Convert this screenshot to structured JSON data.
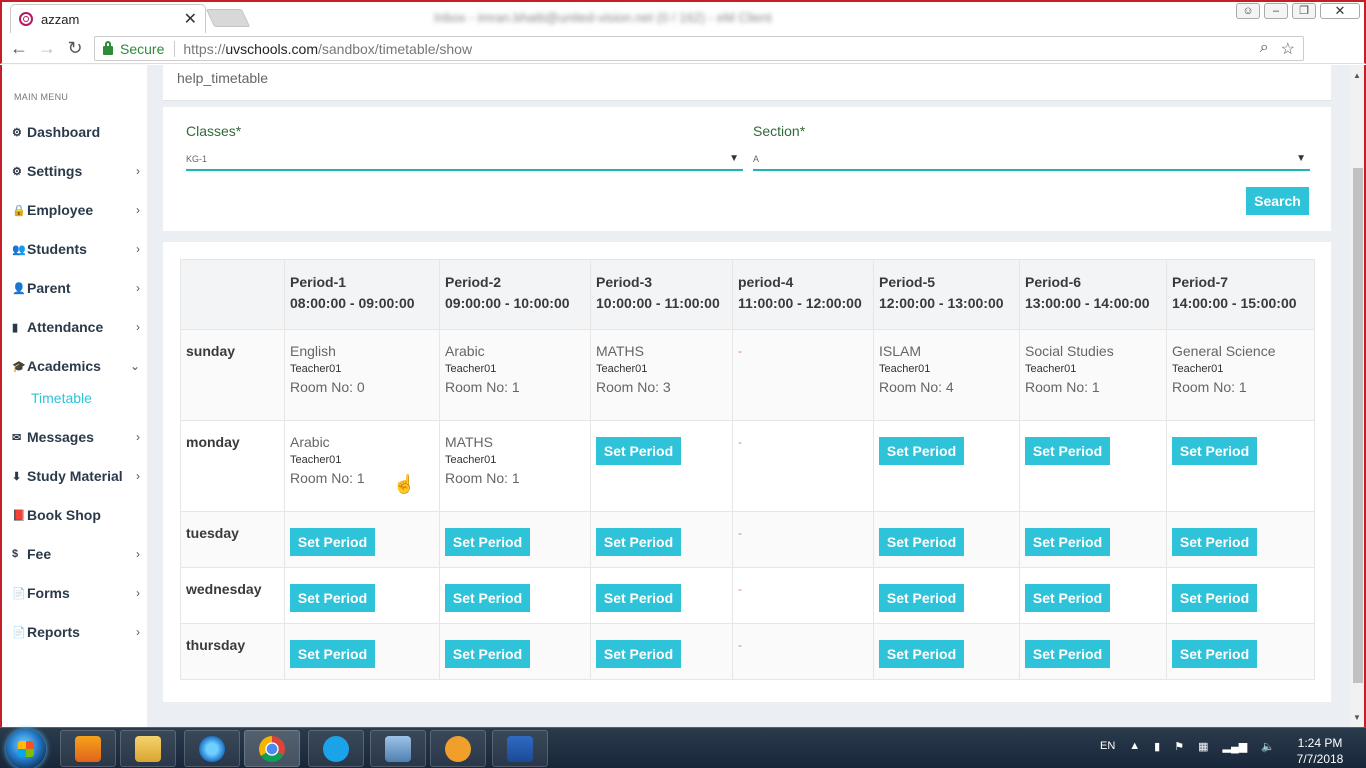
{
  "browser": {
    "tab_title": "azzam",
    "tab_close": "✕",
    "window_title": "Inbox - imran.bhatti@united-vision.net (0 / 162) - eM Client",
    "secure_label": "Secure",
    "url_prefix": "https://",
    "url_host": "uvschools.com",
    "url_path": "/sandbox/timetable/show",
    "back": "←",
    "forward": "→",
    "reload": "↻"
  },
  "sidebar": {
    "heading": "MAIN MENU",
    "items": [
      {
        "label": "Dashboard",
        "icon": "⚙",
        "icon_name": "dashboard-icon",
        "chevron": ""
      },
      {
        "label": "Settings",
        "icon": "⚙",
        "icon_name": "gear-icon",
        "chevron": "›"
      },
      {
        "label": "Employee",
        "icon": "🔒",
        "icon_name": "employee-icon",
        "chevron": "›"
      },
      {
        "label": "Students",
        "icon": "👥",
        "icon_name": "students-icon",
        "chevron": "›"
      },
      {
        "label": "Parent",
        "icon": "👤",
        "icon_name": "parent-icon",
        "chevron": "›"
      },
      {
        "label": "Attendance",
        "icon": "▮",
        "icon_name": "attendance-icon",
        "chevron": "›"
      },
      {
        "label": "Academics",
        "icon": "🎓",
        "icon_name": "academics-icon",
        "chevron": "⌄"
      },
      {
        "label": "Messages",
        "icon": "✉",
        "icon_name": "messages-icon",
        "chevron": "›"
      },
      {
        "label": "Study Material",
        "icon": "⬇",
        "icon_name": "download-icon",
        "chevron": "›"
      },
      {
        "label": "Book Shop",
        "icon": "📕",
        "icon_name": "book-icon",
        "chevron": ""
      },
      {
        "label": "Fee",
        "icon": "$",
        "icon_name": "dollar-icon",
        "chevron": "›"
      },
      {
        "label": "Forms",
        "icon": "📄",
        "icon_name": "forms-icon",
        "chevron": "›"
      },
      {
        "label": "Reports",
        "icon": "📄",
        "icon_name": "reports-icon",
        "chevron": "›"
      }
    ],
    "submenu_active": "Timetable"
  },
  "help": {
    "text": "help_timetable"
  },
  "filters": {
    "classes_label": "Classes*",
    "classes_value": "KG-1",
    "section_label": "Section*",
    "section_value": "A",
    "search_label": "Search"
  },
  "timetable": {
    "periods": [
      {
        "name": "Period-1",
        "time": "08:00:00 - 09:00:00"
      },
      {
        "name": "Period-2",
        "time": "09:00:00 - 10:00:00"
      },
      {
        "name": "Period-3",
        "time": "10:00:00 - 11:00:00"
      },
      {
        "name": "period-4",
        "time": "11:00:00 - 12:00:00"
      },
      {
        "name": "Period-5",
        "time": "12:00:00 - 13:00:00"
      },
      {
        "name": "Period-6",
        "time": "13:00:00 - 14:00:00"
      },
      {
        "name": "Period-7",
        "time": "14:00:00 - 15:00:00"
      }
    ],
    "set_period_label": "Set Period",
    "dash": "-",
    "rows": [
      {
        "day": "sunday",
        "cells": [
          {
            "subject": "English",
            "teacher": "Teacher01",
            "room": "Room No: 0"
          },
          {
            "subject": "Arabic",
            "teacher": "Teacher01",
            "room": "Room No: 1"
          },
          {
            "subject": "MATHS",
            "teacher": "Teacher01",
            "room": "Room No: 3"
          },
          {
            "dash": true
          },
          {
            "subject": "ISLAM",
            "teacher": "Teacher01",
            "room": "Room No: 4"
          },
          {
            "subject": "Social Studies",
            "teacher": "Teacher01",
            "room": "Room No: 1"
          },
          {
            "subject": "General Science",
            "teacher": "Teacher01",
            "room": "Room No: 1"
          }
        ]
      },
      {
        "day": "monday",
        "cells": [
          {
            "subject": "Arabic",
            "teacher": "Teacher01",
            "room": "Room No: 1"
          },
          {
            "subject": "MATHS",
            "teacher": "Teacher01",
            "room": "Room No: 1"
          },
          {
            "set": true
          },
          {
            "dash": true
          },
          {
            "set": true
          },
          {
            "set": true
          },
          {
            "set": true
          }
        ]
      },
      {
        "day": "tuesday",
        "cells": [
          {
            "set": true
          },
          {
            "set": true
          },
          {
            "set": true
          },
          {
            "dash": true
          },
          {
            "set": true
          },
          {
            "set": true
          },
          {
            "set": true
          }
        ]
      },
      {
        "day": "wednesday",
        "cells": [
          {
            "set": true
          },
          {
            "set": true
          },
          {
            "set": true
          },
          {
            "dash": true
          },
          {
            "set": true
          },
          {
            "set": true
          },
          {
            "set": true
          }
        ]
      },
      {
        "day": "thursday",
        "cells": [
          {
            "set": true
          },
          {
            "set": true
          },
          {
            "set": true
          },
          {
            "dash": true
          },
          {
            "set": true
          },
          {
            "set": true
          },
          {
            "set": true
          }
        ]
      }
    ]
  },
  "taskbar": {
    "language": "EN",
    "time": "1:24 PM",
    "date": "7/7/2018",
    "apps": [
      "media-player-icon",
      "file-explorer-icon",
      "internet-explorer-icon",
      "chrome-icon",
      "skype-icon",
      "remote-desktop-icon",
      "em-client-icon",
      "word-icon"
    ]
  }
}
